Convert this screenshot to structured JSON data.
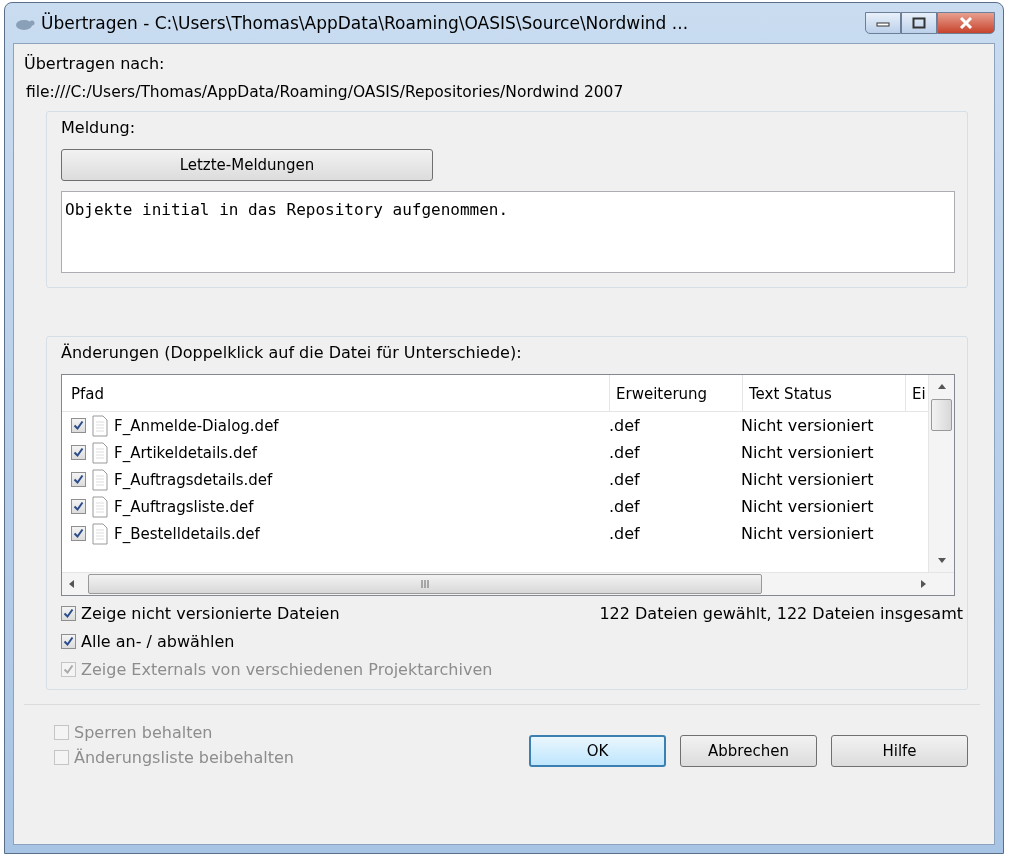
{
  "window": {
    "title": "Übertragen - C:\\Users\\Thomas\\AppData\\Roaming\\OASIS\\Source\\Nordwind ..."
  },
  "target": {
    "label": "Übertragen nach:",
    "url": "file:///C:/Users/Thomas/AppData/Roaming/OASIS/Repositories/Nordwind 2007"
  },
  "message": {
    "label": "Meldung:",
    "recent_button": "Letzte-Meldungen",
    "text": "Objekte initial in das Repository aufgenommen."
  },
  "changes": {
    "label": "Änderungen (Doppelklick auf die Datei für Unterschiede):",
    "columns": [
      "Pfad",
      "Erweiterung",
      "Text Status",
      "Ei"
    ],
    "rows": [
      {
        "checked": true,
        "path": "F_Anmelde-Dialog.def",
        "extension": ".def",
        "status": "Nicht versioniert"
      },
      {
        "checked": true,
        "path": "F_Artikeldetails.def",
        "extension": ".def",
        "status": "Nicht versioniert"
      },
      {
        "checked": true,
        "path": "F_Auftragsdetails.def",
        "extension": ".def",
        "status": "Nicht versioniert"
      },
      {
        "checked": true,
        "path": "F_Auftragsliste.def",
        "extension": ".def",
        "status": "Nicht versioniert"
      },
      {
        "checked": true,
        "path": "F_Bestelldetails.def",
        "extension": ".def",
        "status": "Nicht versioniert"
      }
    ],
    "summary": "122 Dateien gewählt, 122 Dateien insgesamt",
    "options": [
      {
        "label": "Zeige nicht versionierte Dateien",
        "checked": true,
        "disabled": false
      },
      {
        "label": "Alle an- / abwählen",
        "checked": true,
        "disabled": false
      },
      {
        "label": "Zeige Externals von verschiedenen Projektarchiven",
        "checked": true,
        "disabled": true
      }
    ]
  },
  "bottom_options": [
    {
      "label": "Sperren behalten",
      "checked": false,
      "disabled": true
    },
    {
      "label": "Änderungsliste beibehalten",
      "checked": false,
      "disabled": true
    }
  ],
  "buttons": [
    {
      "label": "OK",
      "default": true
    },
    {
      "label": "Abbrechen",
      "default": false
    },
    {
      "label": "Hilfe",
      "default": false
    }
  ]
}
